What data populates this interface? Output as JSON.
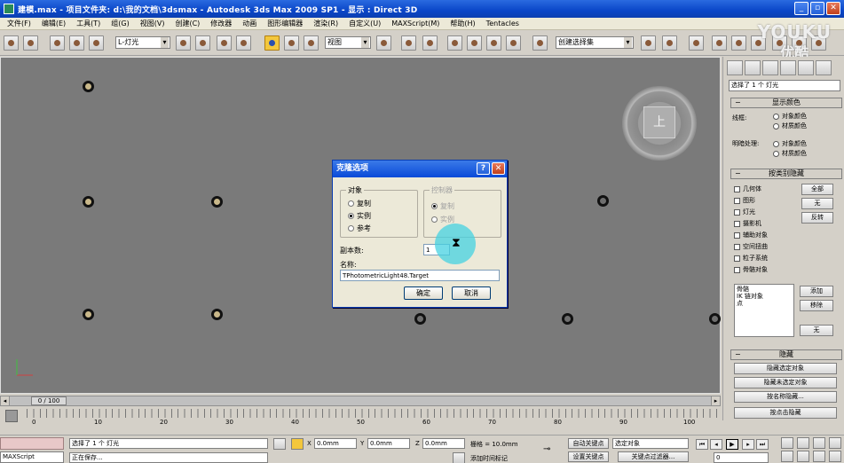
{
  "window": {
    "title": "建模.max   -   项目文件夹: d:\\我的文档\\3dsmax   -   Autodesk 3ds Max   2009 SP1   -   显示 : Direct 3D"
  },
  "menubar": [
    "文件(F)",
    "编辑(E)",
    "工具(T)",
    "组(G)",
    "视图(V)",
    "创建(C)",
    "修改器",
    "动画",
    "图形编辑器",
    "渲染(R)",
    "自定义(U)",
    "MAXScript(M)",
    "帮助(H)",
    "Tentacles"
  ],
  "toolbar": {
    "layer_select": "L-灯光",
    "ref_coord_select": "视图",
    "named_selection": "创建选择集"
  },
  "viewport": {
    "viewcube_label": "上"
  },
  "dialog": {
    "title": "克隆选项",
    "object_group": "对象",
    "object_options": [
      "复制",
      "实例",
      "参考"
    ],
    "object_selected": 1,
    "controller_group": "控制器",
    "controller_options": [
      "复制",
      "实例"
    ],
    "controller_selected": 0,
    "copies_label": "副本数:",
    "copies_value": "1",
    "name_label": "名称:",
    "name_value": "TPhotometricLight48.Target",
    "ok_button": "确定",
    "cancel_button": "取消"
  },
  "command_panel": {
    "selection_text": "选择了 1 个 灯光",
    "display_color_rollout": "显示颜色",
    "wireframe_label": "线框:",
    "shaded_label": "明暗处理:",
    "color_options": [
      "对象颜色",
      "材质颜色"
    ],
    "hide_by_category_rollout": "按类别隐藏",
    "categories": [
      "几何体",
      "图形",
      "灯光",
      "摄影机",
      "辅助对象",
      "空间扭曲",
      "粒子系统",
      "骨骼对象"
    ],
    "category_buttons": [
      "全部",
      "无",
      "反转"
    ],
    "list_items": [
      "骨骼",
      "IK 链对象",
      "点"
    ],
    "add_button": "添加",
    "remove_button": "移除",
    "none_button": "无",
    "hide_rollout": "隐藏",
    "hide_buttons": [
      "隐藏选定对象",
      "隐藏未选定对象",
      "按名称隐藏...",
      "按点击隐藏"
    ]
  },
  "timeline": {
    "frame_display": "0 / 100",
    "ticks": [
      "0",
      "10",
      "20",
      "30",
      "40",
      "50",
      "60",
      "70",
      "80",
      "90",
      "100"
    ]
  },
  "statusbar": {
    "maxscript_label": "MAXScript",
    "status_text": "选择了 1 个 灯光",
    "prompt_text": "正在保存...",
    "x_value": "0.0mm",
    "y_value": "0.0mm",
    "z_value": "0.0mm",
    "grid_text": "栅格 = 10.0mm",
    "add_time_tag": "添加时间标记",
    "auto_key": "自动关键点",
    "set_key": "设置关键点",
    "selected_option": "选定对象",
    "key_filters": "关键点过滤器...",
    "frame_value": "0"
  },
  "watermark": {
    "line1": "YOUKU",
    "line2": "优酷"
  }
}
